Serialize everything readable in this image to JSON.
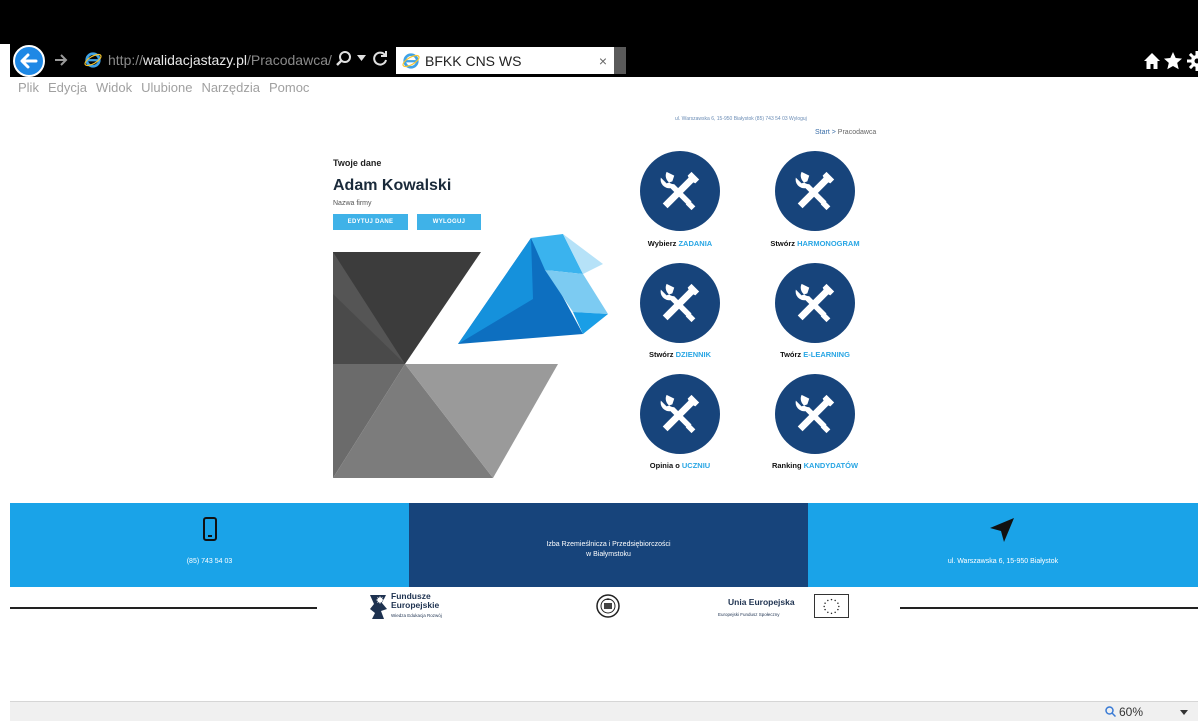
{
  "browser": {
    "url_scheme": "http://",
    "url_host": "walidacjastazy.pl",
    "url_path": "/Pracodawca/",
    "tab_title": "BFKK CNS WS",
    "tab_close": "×",
    "icons": [
      "back-arrow-icon",
      "forward-arrow-icon",
      "ie-logo-icon",
      "search-icon",
      "dropdown-icon",
      "refresh-icon",
      "home-icon",
      "star-icon",
      "gear-icon"
    ]
  },
  "menu": [
    "Plik",
    "Edycja",
    "Widok",
    "Ulubione",
    "Narzędzia",
    "Pomoc"
  ],
  "header": {
    "contact": "ul. Warszawska 6, 15-950 Białystok     (85) 743 54 03     Wyloguj",
    "breadcrumb_start": "Start",
    "breadcrumb_sep": ">",
    "breadcrumb_current": "Pracodawca"
  },
  "profile": {
    "heading": "Twoje dane",
    "name": "Adam Kowalski",
    "company": "Nazwa firmy",
    "edit_label": "EDYTUJ DANE",
    "logout_label": "WYLOGUJ"
  },
  "tiles": [
    {
      "prefix": "Wybierz ",
      "highlight": "ZADANIA",
      "icon": "tools-icon"
    },
    {
      "prefix": "Stwórz ",
      "highlight": "HARMONOGRAM",
      "icon": "tools-icon"
    },
    {
      "prefix": "Stwórz ",
      "highlight": "DZIENNIK",
      "icon": "tools-icon"
    },
    {
      "prefix": "Twórz ",
      "highlight": "E-LEARNING",
      "icon": "tools-icon"
    },
    {
      "prefix": "Opinia o ",
      "highlight": "UCZNIU",
      "icon": "tools-icon"
    },
    {
      "prefix": "Ranking ",
      "highlight": "KANDYDATÓW",
      "icon": "tools-icon"
    }
  ],
  "footer": {
    "phone": "(85) 743 54 03",
    "org_line1": "Izba Rzemieślnicza i Przedsiębiorczości",
    "org_line2": "w Białymstoku",
    "address": "ul. Warszawska 6, 15-950 Białystok"
  },
  "logos": {
    "fe_line1": "Fundusze",
    "fe_line2": "Europejskie",
    "fe_sub": "Wiedza Edukacja Rozwój",
    "ue_title": "Unia Europejska",
    "ue_sub": "Europejski Fundusz Społeczny"
  },
  "status": {
    "zoom": "60%"
  },
  "colors": {
    "primary_blue": "#17447b",
    "accent_blue": "#1aa3e8",
    "button_blue": "#3fb2e8"
  }
}
